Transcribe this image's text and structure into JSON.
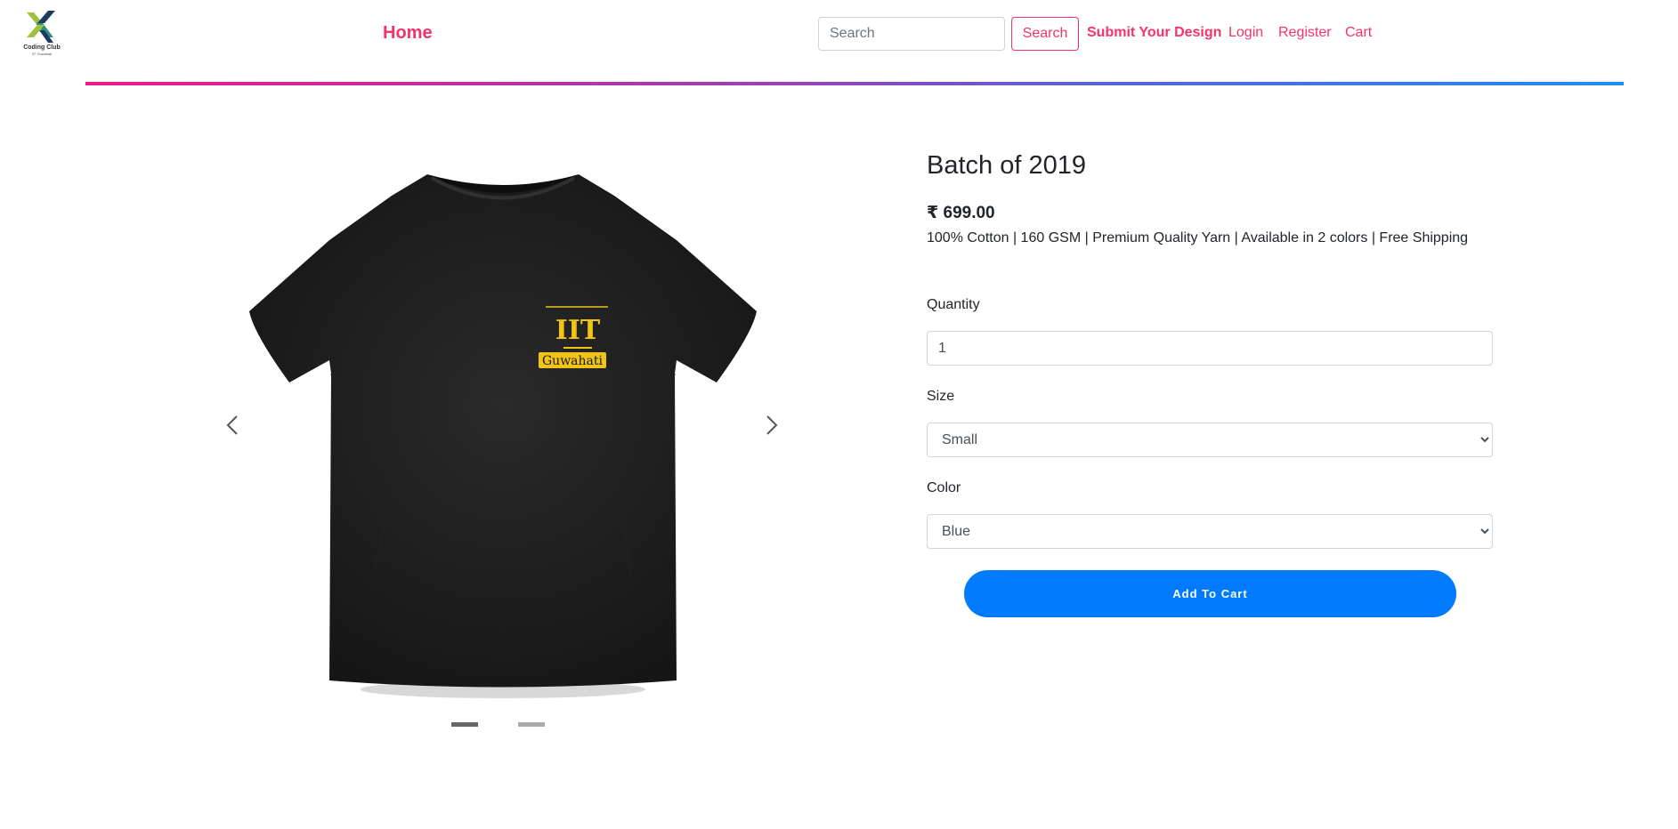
{
  "brand": {
    "logo_text": "Coding Club",
    "logo_subtext": "IIT Guwahati",
    "colors": {
      "green": "#9ec23a",
      "navy": "#1d3a5f",
      "teal": "#2f8f83"
    }
  },
  "nav": {
    "home_label": "Home",
    "search_placeholder": "Search",
    "search_button_label": "Search",
    "submit_design_label": "Submit Your Design",
    "login_label": "Login",
    "register_label": "Register",
    "cart_label": "Cart",
    "accent_color": "#f5336b"
  },
  "carousel": {
    "image_alt": "Black t-shirt with IIT Guwahati logo",
    "shirt_logo_main": "IIT",
    "shirt_logo_badge": "Guwahati",
    "prev_icon": "chevron-left-icon",
    "next_icon": "chevron-right-icon",
    "slide_count": 2,
    "active_slide": 1
  },
  "product": {
    "title": "Batch of 2019",
    "currency_symbol": "₹",
    "price": "699.00",
    "description": "100% Cotton | 160 GSM | Premium Quality Yarn | Available in 2 colors | Free Shipping"
  },
  "form": {
    "quantity_label": "Quantity",
    "quantity_value": "1",
    "size_label": "Size",
    "size_selected": "Small",
    "color_label": "Color",
    "color_selected": "Blue",
    "add_to_cart_label": "Add To Cart",
    "button_color": "#007bff"
  }
}
